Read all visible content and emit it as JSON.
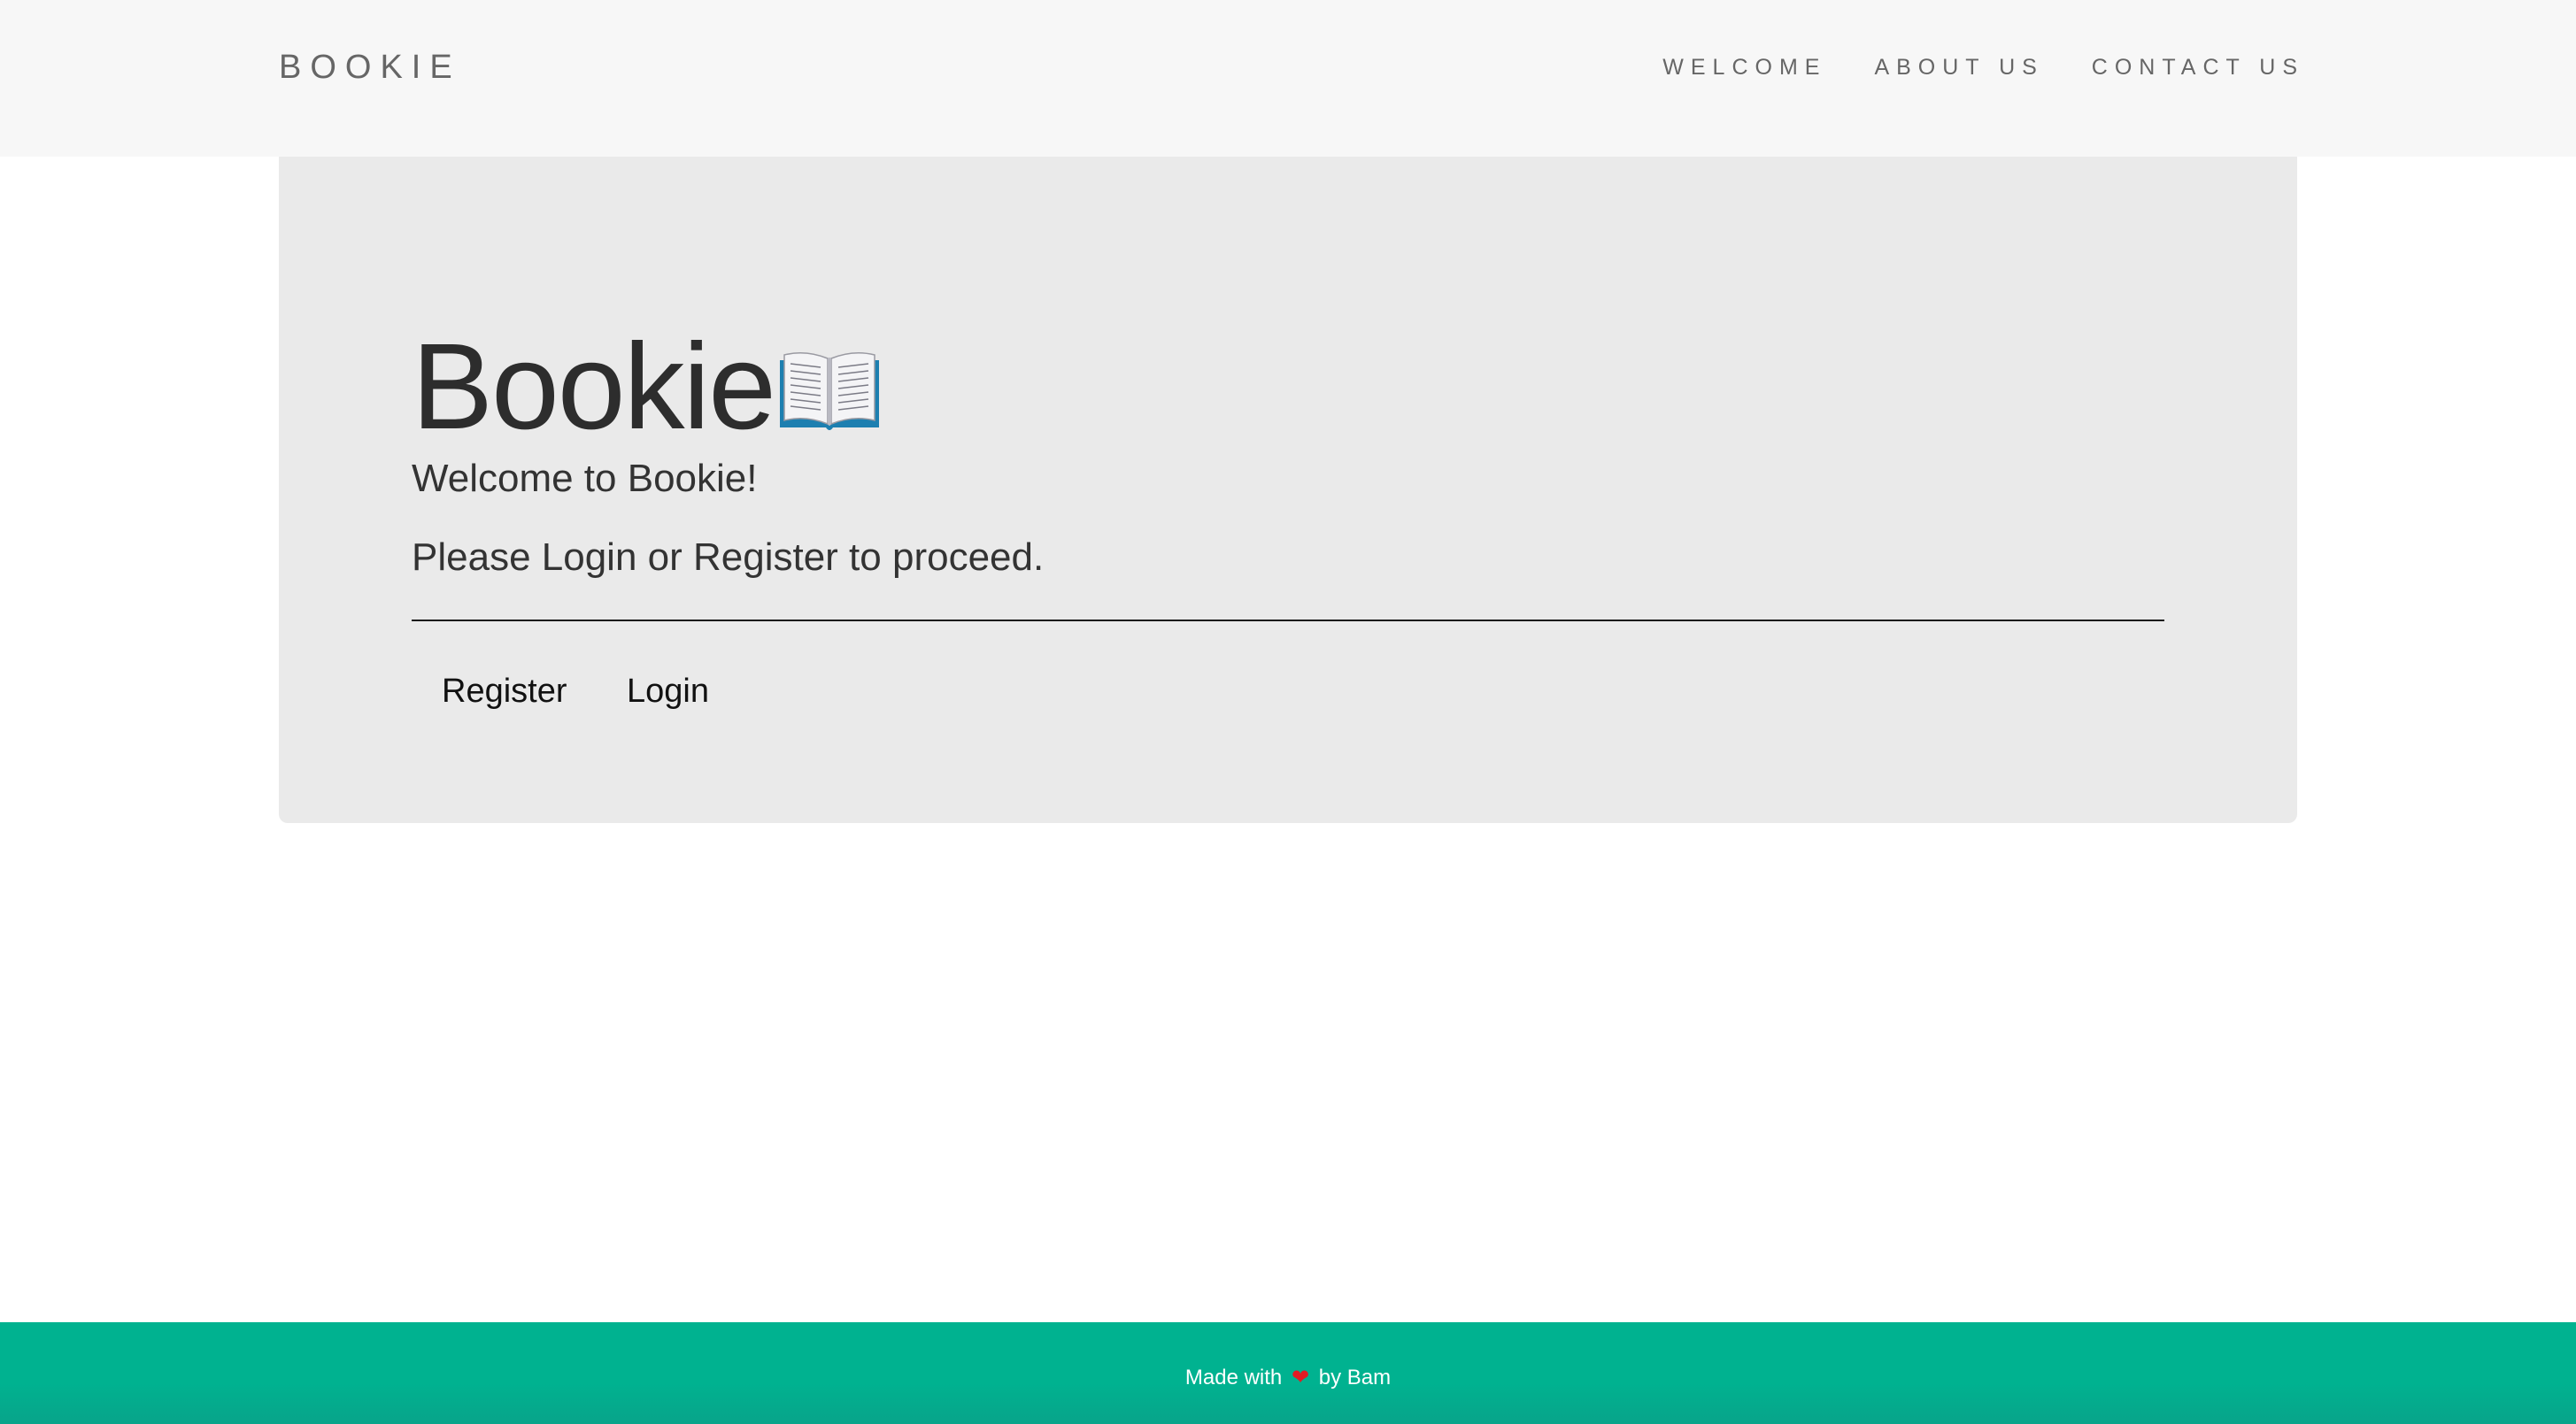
{
  "navbar": {
    "brand": "BOOKIE",
    "links": [
      "WELCOME",
      "ABOUT US",
      "CONTACT US"
    ]
  },
  "hero": {
    "title": "Bookie",
    "title_icon": "open-book-icon",
    "welcome_text": "Welcome to Bookie!",
    "prompt_text": "Please Login or Register to proceed.",
    "register_label": "Register",
    "login_label": "Login"
  },
  "footer": {
    "text_before": "Made with",
    "heart_icon": "heart-icon",
    "heart_glyph": "❤",
    "text_after": "by Bam",
    "background_color": "#00b290"
  },
  "colors": {
    "navbar_bg": "#f7f7f7",
    "jumbotron_bg": "#eaeaea",
    "footer_bg": "#00b290",
    "heart": "#e31b23"
  }
}
